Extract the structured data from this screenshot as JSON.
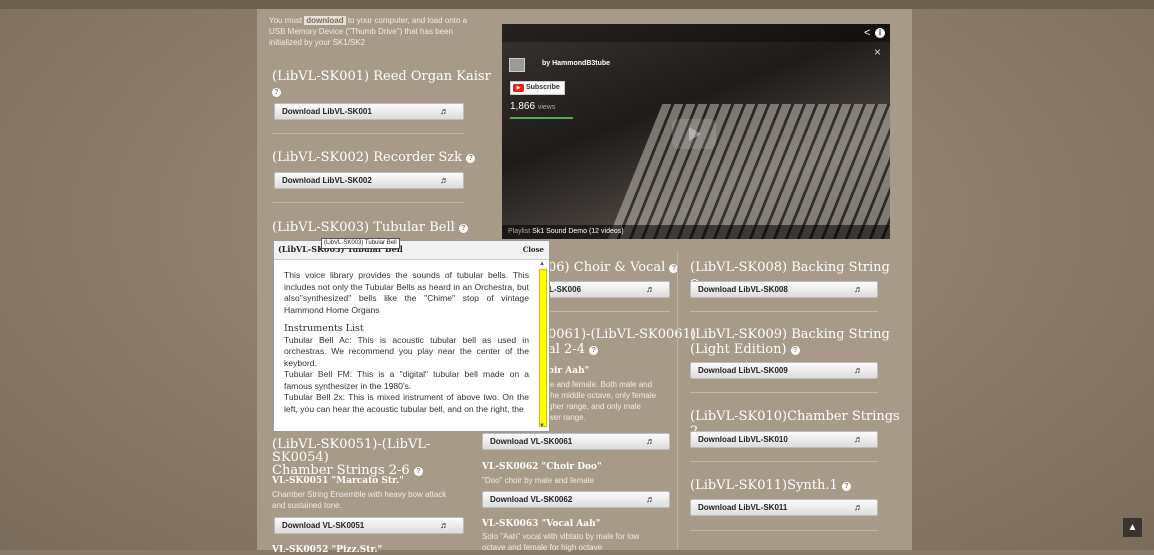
{
  "intro": {
    "line1_pre": "You must ",
    "download_link": "download",
    "line1_post": " to your computer, and load onto a",
    "line2": "USB Memory Device (\"Thumb Drive\") that has been",
    "line3": "initialized by your SK1/SK2"
  },
  "left_column": {
    "sk001_title": "(LibVL-SK001) Reed Organ Kaisr",
    "sk001_button": "Download LibVL-SK001",
    "sk002_title": "(LibVL-SK002) Recorder Szk",
    "sk002_button": "Download LibVL-SK002",
    "sk003_title": "(LibVL-SK003) Tubular Bell",
    "sk0051_title_line1": "(LibVL-SK0051)-(LibVL-SK0054)",
    "sk0051_title_line2": "Chamber Strings 2-6",
    "sk0051_sub": "VL-SK0051 \"Marcato Str.\"",
    "sk0051_desc1": "Chamber String Ensemble with heavy bow attack",
    "sk0051_desc2": "and sustained tone.",
    "sk0051_button": "Download VL-SK0051",
    "sk0052_sub_partial": "VL-SK0052 \"Pizz.Str.\""
  },
  "middle_column": {
    "sk006_title_partial": "06) Choir & Vocal",
    "sk006_button_partial": "L-SK006",
    "sk0061_title_line1_partial": "0061)-(LibVL-SK0061)",
    "sk0061_title_line2_partial": "al 2-4",
    "sk0061_sub_partial": "oir Aah\"",
    "sk0061_desc1_partial": "le and female. Both male and",
    "sk0061_desc2_partial": " the middle octave, only female",
    "sk0061_desc3_partial": "gher range, and only male",
    "sk0061_desc4_partial": "wer range.",
    "sk0061_button": "Download VL-SK0061",
    "sk0062_sub": "VL-SK0062 \"Choir Doo\"",
    "sk0062_desc": "\"Doo\" choir by male and female",
    "sk0062_button": "Download VL-SK0062",
    "sk0063_sub": "VL-SK0063 \"Vocal Aah\"",
    "sk0063_desc1": "Solo \"Aah\" vocal with vibtato by male for low",
    "sk0063_desc2": "octave and female for high octave"
  },
  "right_column": {
    "sk008_title": "(LibVL-SK008) Backing String",
    "sk008_button": "Download LibVL-SK008",
    "sk009_title_line1": "(LibVL-SK009) Backing String",
    "sk009_title_line2": "(Light Edition)",
    "sk009_button": "Download LibVL-SK009",
    "sk010_title": "(LibVL-SK010)Chamber Strings 2",
    "sk010_button": "Download LibVL-SK010",
    "sk011_title": "(LibVL-SK011)Synth.1",
    "sk011_button": "Download LibVL-SK011"
  },
  "video": {
    "channel": "by HammondB3tube",
    "subscribe": "Subscribe",
    "views_count": "1,866",
    "views_label": "views",
    "playlist_label": "Playlist",
    "playlist_title": "Sk1 Sound Demo (12 videos)",
    "close": "×",
    "info": "i"
  },
  "popup": {
    "title": "(LibVL-SK003) Tubular Bell",
    "tooltip": "(LibVL-SK003) Tubular Bell",
    "close": "Close",
    "p1": "This voice library provides the sounds of tubular bells. This includes not only the Tubular Bells as heard in an Orchestra, but also\"synthesized\" bells like the \"Chime\" stop of vintage Hammond Home Organs",
    "list_heading": "Instruments List",
    "p2": "Tubular Bell Ac: This is acoustic tubular bell as used in orchestras. We recommend you play near the center of the keybord.",
    "p3": "Tubular Bell FM: This is a \"digital\" tubular bell made on a famous synthesizer in the 1980's.",
    "p4": "Tubular Bell 2x: This is mixed instrument of above two. On the left, you can hear the acoustic tubular bell, and on the right, the"
  },
  "icons": {
    "note_glyph": "♬",
    "info_glyph": "?",
    "up_arrow_glyph": "▲"
  },
  "colors": {
    "background": "#8a7a69",
    "panel": "#a89a88",
    "scroll_thumb": "#ffff00",
    "views_bar": "#4caf50",
    "youtube_red": "#e62117"
  }
}
